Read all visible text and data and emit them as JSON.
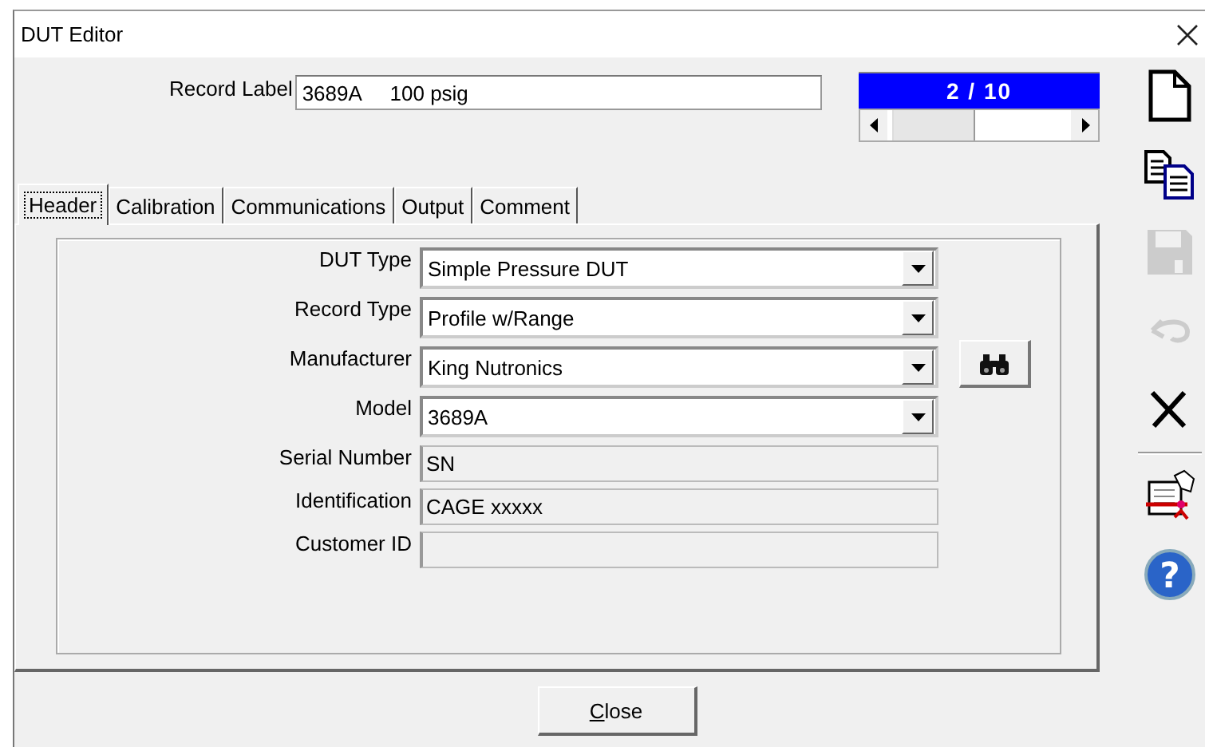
{
  "window": {
    "title": "DUT Editor"
  },
  "record": {
    "label": "Record Label",
    "value": "3689A     100 psig"
  },
  "navigator": {
    "position": "2 / 10"
  },
  "tabs": [
    {
      "label": "Header",
      "selected": true
    },
    {
      "label": "Calibration",
      "selected": false
    },
    {
      "label": "Communications",
      "selected": false
    },
    {
      "label": "Output",
      "selected": false
    },
    {
      "label": "Comment",
      "selected": false
    }
  ],
  "fields": [
    {
      "label": "DUT Type",
      "value": "Simple Pressure DUT",
      "kind": "dropdown",
      "search_button": false
    },
    {
      "label": "Record Type",
      "value": "Profile w/Range",
      "kind": "dropdown",
      "search_button": false
    },
    {
      "label": "Manufacturer",
      "value": "King Nutronics",
      "kind": "dropdown",
      "search_button": true
    },
    {
      "label": "Model",
      "value": "3689A",
      "kind": "dropdown",
      "search_button": false
    },
    {
      "label": "Serial Number",
      "value": "SN",
      "kind": "readonly",
      "search_button": false
    },
    {
      "label": "Identification",
      "value": "CAGE xxxxx",
      "kind": "readonly",
      "search_button": false
    },
    {
      "label": "Customer ID",
      "kind": "readonly",
      "search_button": false
    }
  ],
  "toolbar": [
    {
      "kind": "new",
      "disabled": false
    },
    {
      "kind": "copy",
      "disabled": false
    },
    {
      "kind": "save",
      "disabled": true
    },
    {
      "kind": "undo",
      "disabled": true
    },
    {
      "kind": "delete",
      "disabled": false
    },
    {
      "kind": "separator"
    },
    {
      "kind": "wizard",
      "disabled": false
    },
    {
      "kind": "help",
      "disabled": false,
      "glyph": "?"
    }
  ],
  "close_button": {
    "label": "Close",
    "mnemonic": true
  }
}
